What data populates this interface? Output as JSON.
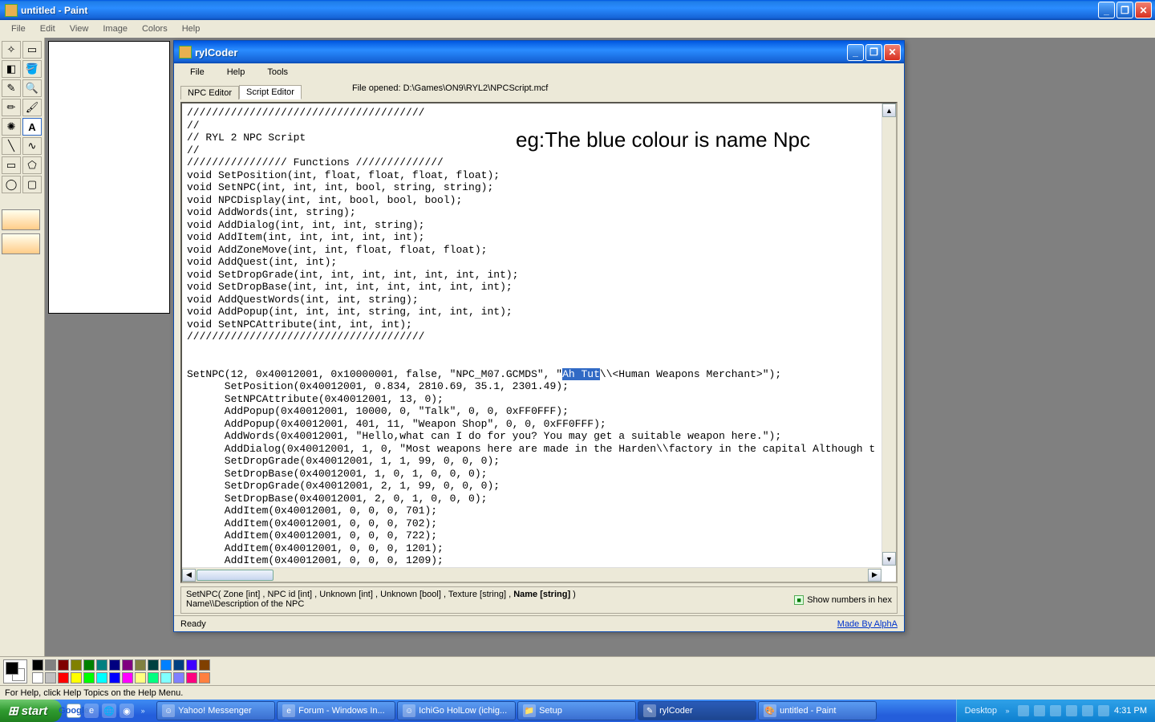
{
  "paint": {
    "title": "untitled - Paint",
    "menus": [
      "File",
      "Edit",
      "View",
      "Image",
      "Colors",
      "Help"
    ],
    "status": "For Help, click Help Topics on the Help Menu.",
    "palette_top": [
      "#000000",
      "#808080",
      "#800000",
      "#808000",
      "#008000",
      "#008080",
      "#000080",
      "#800080",
      "#808040",
      "#004040",
      "#0080ff",
      "#004080",
      "#4000ff",
      "#804000"
    ],
    "palette_bottom": [
      "#ffffff",
      "#c0c0c0",
      "#ff0000",
      "#ffff00",
      "#00ff00",
      "#00ffff",
      "#0000ff",
      "#ff00ff",
      "#ffff80",
      "#00ff80",
      "#80ffff",
      "#8080ff",
      "#ff0080",
      "#ff8040"
    ]
  },
  "rylcoder": {
    "title": "rylCoder",
    "menus": [
      "File",
      "Help",
      "Tools"
    ],
    "tabs": {
      "npc": "NPC Editor",
      "script": "Script Editor"
    },
    "file_opened_label": "File opened: D:\\Games\\ON9\\RYL2\\NPCScript.mcf",
    "annotation": "eg:The blue colour is name\nNpc",
    "script_pre": "//////////////////////////////////////\n//\n// RYL 2 NPC Script\n//\n//////////////// Functions //////////////\nvoid SetPosition(int, float, float, float, float);\nvoid SetNPC(int, int, int, bool, string, string);\nvoid NPCDisplay(int, int, bool, bool, bool);\nvoid AddWords(int, string);\nvoid AddDialog(int, int, int, string);\nvoid AddItem(int, int, int, int, int);\nvoid AddZoneMove(int, int, float, float, float);\nvoid AddQuest(int, int);\nvoid SetDropGrade(int, int, int, int, int, int, int);\nvoid SetDropBase(int, int, int, int, int, int, int);\nvoid AddQuestWords(int, int, string);\nvoid AddPopup(int, int, int, string, int, int, int);\nvoid SetNPCAttribute(int, int, int);\n//////////////////////////////////////\n\n\nSetNPC(12, 0x40012001, 0x10000001, false, \"NPC_M07.GCMDS\", \"",
    "script_sel": "Ah Tut",
    "script_post": "\\\\<Human Weapons Merchant>\");\n      SetPosition(0x40012001, 0.834, 2810.69, 35.1, 2301.49);\n      SetNPCAttribute(0x40012001, 13, 0);\n      AddPopup(0x40012001, 10000, 0, \"Talk\", 0, 0, 0xFF0FFF);\n      AddPopup(0x40012001, 401, 11, \"Weapon Shop\", 0, 0, 0xFF0FFF);\n      AddWords(0x40012001, \"Hello,what can I do for you? You may get a suitable weapon here.\");\n      AddDialog(0x40012001, 1, 0, \"Most weapons here are made in the Harden\\\\factory in the capital Although t\n      SetDropGrade(0x40012001, 1, 1, 99, 0, 0, 0);\n      SetDropBase(0x40012001, 1, 0, 1, 0, 0, 0);\n      SetDropGrade(0x40012001, 2, 1, 99, 0, 0, 0);\n      SetDropBase(0x40012001, 2, 0, 1, 0, 0, 0);\n      AddItem(0x40012001, 0, 0, 0, 701);\n      AddItem(0x40012001, 0, 0, 0, 702);\n      AddItem(0x40012001, 0, 0, 0, 722);\n      AddItem(0x40012001, 0, 0, 0, 1201);\n      AddItem(0x40012001, 0, 0, 0, 1209);",
    "hint_line1_a": "SetNPC( Zone [int] , NPC id [int] , Unknown [int] , Unknown [bool] , Texture [string] , ",
    "hint_line1_bold": "Name [string]",
    "hint_line1_b": " )",
    "hint_line2": "Name\\\\Description of the NPC",
    "show_hex": "Show numbers in hex",
    "status_left": "Ready",
    "status_right": "Made By AlphA"
  },
  "taskbar": {
    "start": "start",
    "ql_google": "Google",
    "buttons": [
      {
        "label": "Yahoo! Messenger",
        "icon": "☺"
      },
      {
        "label": "Forum - Windows In...",
        "icon": "e"
      },
      {
        "label": "IchiGo HolLow (ichig...",
        "icon": "☺"
      },
      {
        "label": "Setup",
        "icon": "📁"
      },
      {
        "label": "rylCoder",
        "icon": "✎",
        "active": true
      },
      {
        "label": "untitled - Paint",
        "icon": "🎨"
      }
    ],
    "desktop": "Desktop",
    "clock": "4:31 PM"
  }
}
